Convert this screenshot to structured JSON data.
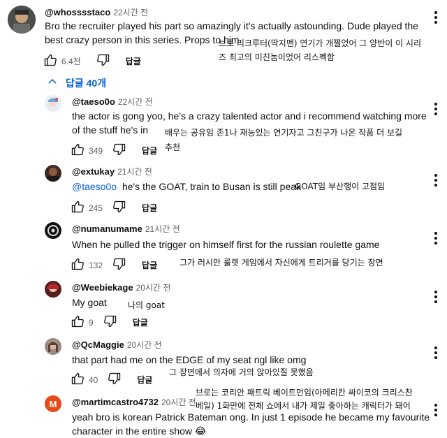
{
  "main_comment": {
    "author": "@whosssstaco",
    "time": "22시간 전",
    "text": "Bro the recruiter played his part so amazingly it's actually astounding. Dude played the best crazy person in this series. Props to him.",
    "note_line1": "브로 리크루터(딱지맨) 연기가 개쩔었어 그 양반이 이 시리",
    "note_line2": "즈 최고의 미친놈이었어 리스펙함",
    "likes": "6.4천",
    "reply_label": "답글"
  },
  "replies_toggle": {
    "label": "답글 40개"
  },
  "replies": [
    {
      "author": "@taeso0o",
      "time": "22시간 전",
      "text": "the actor is gong yoo, he's a crazy talented actor and i recommend watching more of the stuff he's in",
      "note_line1": "배우는 공유임 존1나 재능있는 연기자고 그친구가 나온 작품 더 보길",
      "note_line2": "추천",
      "likes": "349",
      "reply_label": "답글"
    },
    {
      "author": "@extukay",
      "time": "21시간 전",
      "mention": "@taeso0o",
      "text": "he's the GOAT, train to Busan is still peak",
      "note": "GOAT임 부산행이 고점임",
      "likes": "245",
      "reply_label": "답글"
    },
    {
      "author": "@numanumame",
      "time": "21시간 전",
      "text": "When he pulled the trigger on himself first for the russian roulette game",
      "note": "그가 러시안 룰렛 게임에서 자신에게 트리거를 당기는 장면",
      "likes": "132",
      "reply_label": "답글"
    },
    {
      "author": "@Weebiekage",
      "time": "20시간 전",
      "text": "My goat",
      "note": "나의 goat",
      "likes": "9",
      "reply_label": "답글"
    },
    {
      "author": "@QcMaggie",
      "time": "20시간 전",
      "text": "that part had me on the EDGE of my seat ngl like omg",
      "note": "그 장면에서 의자에 거의 앉아있질 못했음",
      "likes": "40",
      "reply_label": "답글"
    },
    {
      "author": "@martimcastro4732",
      "time": "20시간 전",
      "avatar_letter": "M",
      "text_line1": "yeah bro is korean Patrick Bateman ong.  In just 1 episode he became my favourite",
      "text_line2": "character in the entire show",
      "emoji": "😂",
      "note_line1": "브로는 코리안 패트릭 베이트먼임(아메리칸 싸이코의 크리스찬",
      "note_line2": "베일) 1화만에 전체 쇼에서 내가 제일 좋아하는 캐릭터가 돼어"
    }
  ],
  "colors": {
    "link": "#065fd4",
    "text": "#0f0f0f",
    "muted": "#606060",
    "avatar_m": "#e64a19"
  },
  "icons": [
    "thumbs-up-icon",
    "thumbs-down-icon",
    "chevron-up-icon",
    "more-vert-icon"
  ]
}
